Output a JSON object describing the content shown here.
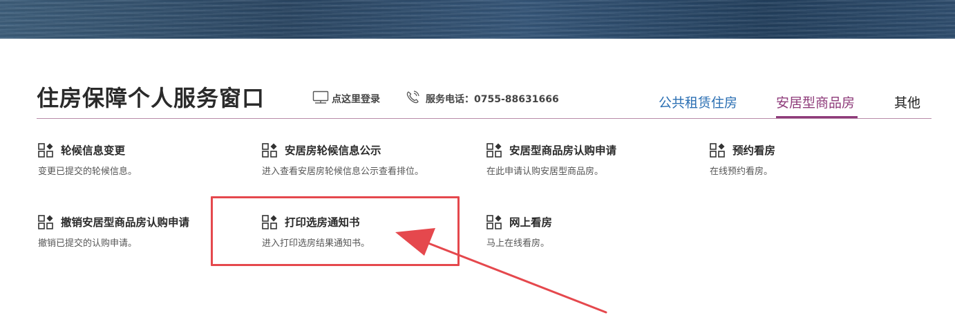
{
  "header": {
    "title": "住房保障个人服务窗口",
    "login_label": "点这里登录",
    "phone_label": "服务电话：0755-88631666"
  },
  "tabs": [
    {
      "label": "公共租赁住房",
      "state": "default",
      "color": "#2b6fb3"
    },
    {
      "label": "安居型商品房",
      "state": "active",
      "color": "#8e3b7a"
    },
    {
      "label": "其他",
      "state": "default",
      "color": "#222222"
    }
  ],
  "services": [
    {
      "name": "轮候信息变更",
      "desc": "变更已提交的轮候信息。"
    },
    {
      "name": "安居房轮候信息公示",
      "desc": "进入查看安居房轮候信息公示查看排位。"
    },
    {
      "name": "安居型商品房认购申请",
      "desc": "在此申请认购安居型商品房。"
    },
    {
      "name": "预约看房",
      "desc": "在线预约看房。"
    },
    {
      "name": "撤销安居型商品房认购申请",
      "desc": "撤销已提交的认购申请。"
    },
    {
      "name": "打印选房通知书",
      "desc": "进入打印选房结果通知书。"
    },
    {
      "name": "网上看房",
      "desc": "马上在线看房。"
    }
  ],
  "icons": {
    "service": "grid-icon",
    "login": "monitor-icon",
    "phone": "phone-icon"
  },
  "annotation": {
    "box_color": "#e5484d",
    "arrow_color": "#e5484d"
  }
}
